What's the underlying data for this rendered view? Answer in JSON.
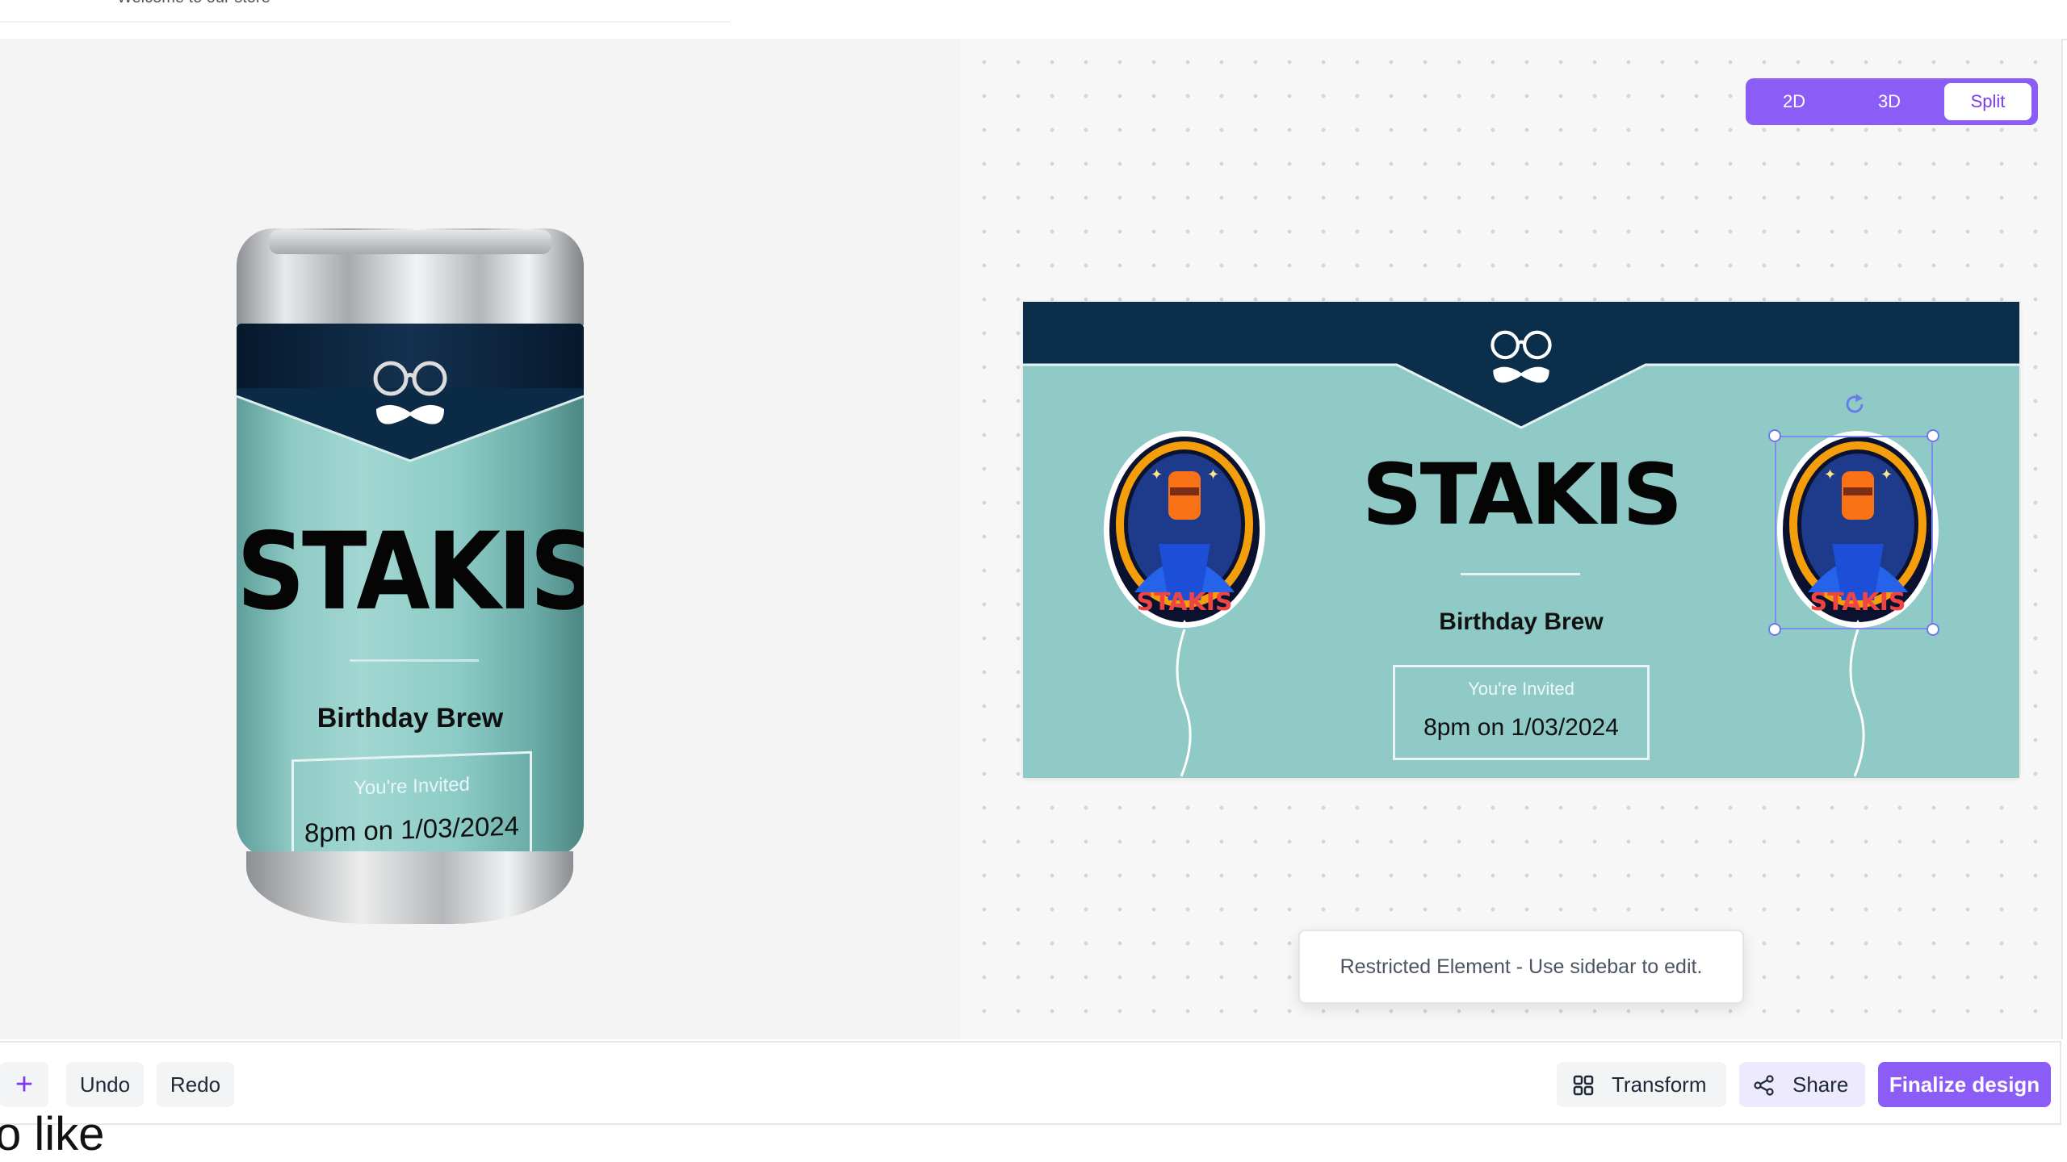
{
  "header": {
    "welcome_text": "Welcome to our store"
  },
  "view_toggle": {
    "options": [
      "2D",
      "3D",
      "Split"
    ],
    "active": "Split"
  },
  "label": {
    "brand": "STAKIS",
    "subtitle": "Birthday Brew",
    "invite_heading": "You're Invited",
    "invite_datetime": "8pm on 1/03/2024",
    "badge_text": "STAKIS"
  },
  "toast": {
    "message": "Restricted Element - Use sidebar to edit."
  },
  "toolbar": {
    "add_label": "+",
    "undo_label": "Undo",
    "redo_label": "Redo",
    "transform_label": "Transform",
    "share_label": "Share",
    "finalize_label": "Finalize design"
  },
  "footer": {
    "partial_text": "o like"
  },
  "colors": {
    "accent": "#8b5cf6",
    "label_background": "#8fcac7",
    "label_band": "#0b2f4b"
  }
}
